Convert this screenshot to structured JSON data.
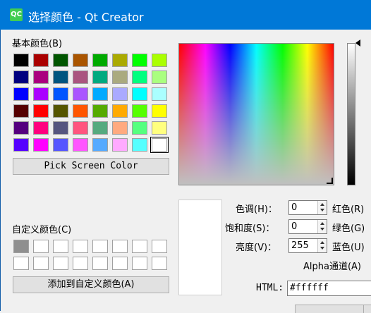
{
  "window": {
    "title": "选择颜色 - Qt Creator",
    "icon_text": "QC"
  },
  "basic_colors": {
    "label": "基本颜色(B)",
    "colors": [
      [
        "#000000",
        "#aa0000",
        "#005500",
        "#aa5500",
        "#00aa00",
        "#aaaa00",
        "#00ff00",
        "#aaff00"
      ],
      [
        "#00007f",
        "#aa007f",
        "#00557f",
        "#aa557f",
        "#00aa7f",
        "#aaaa7f",
        "#00ff7f",
        "#aaff7f"
      ],
      [
        "#0000ff",
        "#aa00ff",
        "#0055ff",
        "#aa55ff",
        "#00aaff",
        "#aaaaff",
        "#00ffff",
        "#aaffff"
      ],
      [
        "#550000",
        "#ff0000",
        "#555500",
        "#ff5500",
        "#55aa00",
        "#ffaa00",
        "#55ff00",
        "#ffff00"
      ],
      [
        "#55007f",
        "#ff007f",
        "#55557f",
        "#ff557f",
        "#55aa7f",
        "#ffaa7f",
        "#55ff7f",
        "#ffff7f"
      ],
      [
        "#5500ff",
        "#ff00ff",
        "#5555ff",
        "#ff55ff",
        "#55aaff",
        "#ffaaff",
        "#55ffff",
        "#ffffff"
      ]
    ]
  },
  "pick_screen_color": "Pick Screen Color",
  "custom_colors": {
    "label": "自定义颜色(C)",
    "colors": [
      [
        "#8f8f8f",
        "#ffffff",
        "#ffffff",
        "#ffffff",
        "#ffffff",
        "#ffffff",
        "#ffffff",
        "#ffffff"
      ],
      [
        "#ffffff",
        "#ffffff",
        "#ffffff",
        "#ffffff",
        "#ffffff",
        "#ffffff",
        "#ffffff",
        "#ffffff"
      ]
    ]
  },
  "add_custom": "添加到自定义颜色(A)",
  "fields": {
    "hue": {
      "label": "色调(H)：",
      "value": "0"
    },
    "sat": {
      "label": "饱和度(S)：",
      "value": "0"
    },
    "val": {
      "label": "亮度(V)：",
      "value": "255"
    },
    "red": {
      "label": "红色(R)"
    },
    "green": {
      "label": "绿色(G)"
    },
    "blue": {
      "label": "蓝色(U)"
    },
    "alpha": {
      "label": "Alpha通道(A)"
    },
    "html": {
      "label": "HTML:",
      "value": "#ffffff"
    }
  },
  "preview_color": "#ffffff"
}
